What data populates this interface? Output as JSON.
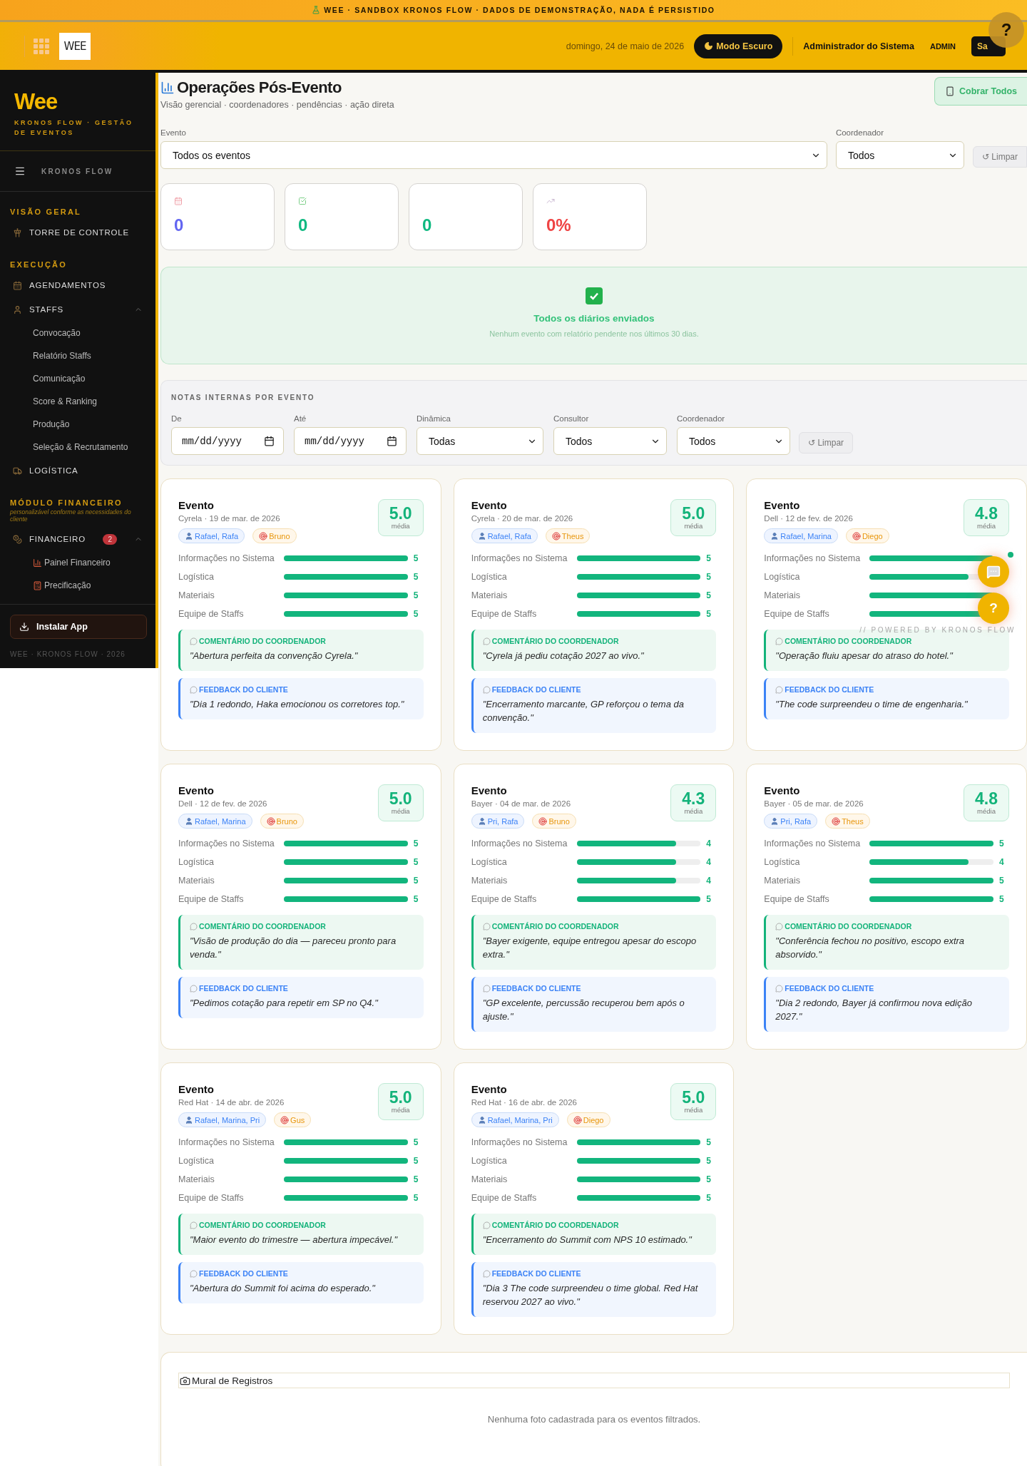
{
  "banner": {
    "text": "WEE · SANDBOX KRONOS FLOW · DADOS DE DEMONSTRAÇÃO, NADA É PERSISTIDO"
  },
  "header": {
    "logo": "WEE",
    "date": "domingo, 24 de maio de 2026",
    "dark_mode_button": "Modo Escuro",
    "user": "Administrador do Sistema",
    "role": "ADMIN",
    "logout_button": "Sa",
    "help_button": "?"
  },
  "sidebar": {
    "brand": "Wee",
    "tagline": "KRONOS FLOW · GESTÃO DE EVENTOS",
    "menu_label": "KRONOS FLOW",
    "sections": [
      {
        "title": "VISÃO GERAL",
        "items": [
          {
            "label": "TORRE DE CONTROLE"
          }
        ]
      },
      {
        "title": "EXECUÇÃO",
        "items": [
          {
            "label": "AGENDAMENTOS"
          },
          {
            "label": "STAFFS",
            "expanded": true,
            "children": [
              {
                "label": "Convocação"
              },
              {
                "label": "Relatório Staffs"
              },
              {
                "label": "Comunicação"
              },
              {
                "label": "Score & Ranking"
              },
              {
                "label": "Produção"
              },
              {
                "label": "Seleção & Recrutamento"
              }
            ]
          },
          {
            "label": "LOGÍSTICA"
          }
        ]
      },
      {
        "title": "MÓDULO FINANCEIRO",
        "note": "personalizável conforme as necessidades do cliente",
        "items": [
          {
            "label": "FINANCEIRO",
            "badge": "2",
            "expanded": true,
            "children": [
              {
                "label": "Painel Financeiro"
              },
              {
                "label": "Precificação"
              }
            ]
          }
        ]
      }
    ],
    "install_button": "Instalar App",
    "footer": "WEE · KRONOS FLOW · 2026"
  },
  "page": {
    "title": "Operações Pós-Evento",
    "subtitle": "Visão gerencial · coordenadores · pendências · ação direta",
    "action_button": "Cobrar Todos"
  },
  "filters": {
    "fields": [
      {
        "label": "Evento",
        "value": "Todos os eventos"
      },
      {
        "label": "Coordenador",
        "value": "Todos"
      }
    ],
    "clear_button": "↺ Limpar"
  },
  "kpis": [
    {
      "value": "0",
      "color": "#6366f1"
    },
    {
      "value": "0",
      "color": "#10b981"
    },
    {
      "value": "0",
      "color": "#10b981"
    },
    {
      "value": "0%",
      "color": "#ef4444"
    }
  ],
  "success": {
    "title": "Todos os diários enviados",
    "text": "Nenhum evento com relatório pendente nos últimos 30 dias."
  },
  "notes": {
    "title": "NOTAS INTERNAS POR EVENTO",
    "fields": [
      {
        "kind": "date",
        "label": "De",
        "placeholder": "mm/dd/yyyy"
      },
      {
        "kind": "date",
        "label": "Até",
        "placeholder": "mm/dd/yyyy"
      },
      {
        "kind": "select",
        "label": "Dinâmica",
        "value": "Todas"
      },
      {
        "kind": "select",
        "label": "Consultor",
        "value": "Todos"
      },
      {
        "kind": "select",
        "label": "Coordenador",
        "value": "Todos"
      }
    ],
    "clear_button": "↺ Limpar"
  },
  "events": [
    {
      "title": "Evento",
      "subtitle": "Cyrela · 19 de mar. de 2026",
      "coordinators": "Rafael, Rafa",
      "consultant": "Bruno",
      "score": "5.0",
      "score_label": "média",
      "ratings": [
        {
          "label": "Informações no Sistema",
          "level": 1,
          "value": "5"
        },
        {
          "label": "Logística",
          "level": 1,
          "value": "5"
        },
        {
          "label": "Materiais",
          "level": 1,
          "value": "5"
        },
        {
          "label": "Equipe de Staffs",
          "level": 1,
          "value": "5"
        }
      ],
      "comment": {
        "label": "COMENTÁRIO DO COORDENADOR",
        "text": "\"Abertura perfeita da convenção Cyrela.\""
      },
      "feedback": {
        "label": "FEEDBACK DO CLIENTE",
        "text": "\"Dia 1 redondo, Haka emocionou os corretores top.\""
      }
    },
    {
      "title": "Evento",
      "subtitle": "Cyrela · 20 de mar. de 2026",
      "coordinators": "Rafael, Rafa",
      "consultant": "Theus",
      "score": "5.0",
      "score_label": "média",
      "ratings": [
        {
          "label": "Informações no Sistema",
          "level": 1,
          "value": "5"
        },
        {
          "label": "Logística",
          "level": 1,
          "value": "5"
        },
        {
          "label": "Materiais",
          "level": 1,
          "value": "5"
        },
        {
          "label": "Equipe de Staffs",
          "level": 1,
          "value": "5"
        }
      ],
      "comment": {
        "label": "COMENTÁRIO DO COORDENADOR",
        "text": "\"Cyrela já pediu cotação 2027 ao vivo.\""
      },
      "feedback": {
        "label": "FEEDBACK DO CLIENTE",
        "text": "\"Encerramento marcante, GP reforçou o tema da convenção.\""
      }
    },
    {
      "title": "Evento",
      "subtitle": "Dell · 12 de fev. de 2026",
      "coordinators": "Rafael, Marina",
      "consultant": "Diego",
      "score": "4.8",
      "score_label": "média",
      "ratings": [
        {
          "label": "Informações no Sistema",
          "level": 1
        },
        {
          "label": "Logística",
          "level": 0.8
        },
        {
          "label": "Materiais",
          "level": 1
        },
        {
          "label": "Equipe de Staffs",
          "level": 1
        }
      ],
      "comment": {
        "label": "COMENTÁRIO DO COORDENADOR",
        "text": "\"Operação fluiu apesar do atraso do hotel.\""
      },
      "feedback": {
        "label": "FEEDBACK DO CLIENTE",
        "text": "\"The code surpreendeu o time de engenharia.\""
      }
    },
    {
      "title": "Evento",
      "subtitle": "Dell · 12 de fev. de 2026",
      "coordinators": "Rafael, Marina",
      "consultant": "Bruno",
      "score": "5.0",
      "score_label": "média",
      "ratings": [
        {
          "label": "Informações no Sistema",
          "level": 1,
          "value": "5"
        },
        {
          "label": "Logística",
          "level": 1,
          "value": "5"
        },
        {
          "label": "Materiais",
          "level": 1,
          "value": "5"
        },
        {
          "label": "Equipe de Staffs",
          "level": 1,
          "value": "5"
        }
      ],
      "comment": {
        "label": "COMENTÁRIO DO COORDENADOR",
        "text": "\"Visão de produção do dia — pareceu pronto para venda.\""
      },
      "feedback": {
        "label": "FEEDBACK DO CLIENTE",
        "text": "\"Pedimos cotação para repetir em SP no Q4.\""
      }
    },
    {
      "title": "Evento",
      "subtitle": "Bayer · 04 de mar. de 2026",
      "coordinators": "Pri, Rafa",
      "consultant": "Bruno",
      "score": "4.3",
      "score_label": "média",
      "ratings": [
        {
          "label": "Informações no Sistema",
          "level": 0.8,
          "value": "4"
        },
        {
          "label": "Logística",
          "level": 0.8,
          "value": "4"
        },
        {
          "label": "Materiais",
          "level": 0.8,
          "value": "4"
        },
        {
          "label": "Equipe de Staffs",
          "level": 1,
          "value": "5"
        }
      ],
      "comment": {
        "label": "COMENTÁRIO DO COORDENADOR",
        "text": "\"Bayer exigente, equipe entregou apesar do escopo extra.\""
      },
      "feedback": {
        "label": "FEEDBACK DO CLIENTE",
        "text": "\"GP excelente, percussão recuperou bem após o ajuste.\""
      }
    },
    {
      "title": "Evento",
      "subtitle": "Bayer · 05 de mar. de 2026",
      "coordinators": "Pri, Rafa",
      "consultant": "Theus",
      "score": "4.8",
      "score_label": "média",
      "ratings": [
        {
          "label": "Informações no Sistema",
          "level": 1,
          "value": "5"
        },
        {
          "label": "Logística",
          "level": 0.8,
          "value": "4"
        },
        {
          "label": "Materiais",
          "level": 1,
          "value": "5"
        },
        {
          "label": "Equipe de Staffs",
          "level": 1,
          "value": "5"
        }
      ],
      "comment": {
        "label": "COMENTÁRIO DO COORDENADOR",
        "text": "\"Conferência fechou no positivo, escopo extra absorvido.\""
      },
      "feedback": {
        "label": "FEEDBACK DO CLIENTE",
        "text": "\"Dia 2 redondo, Bayer já confirmou nova edição 2027.\""
      }
    },
    {
      "title": "Evento",
      "subtitle": "Red Hat · 14 de abr. de 2026",
      "coordinators": "Rafael, Marina, Pri",
      "consultant": "Gus",
      "score": "5.0",
      "score_label": "média",
      "ratings": [
        {
          "label": "Informações no Sistema",
          "level": 1,
          "value": "5"
        },
        {
          "label": "Logística",
          "level": 1,
          "value": "5"
        },
        {
          "label": "Materiais",
          "level": 1,
          "value": "5"
        },
        {
          "label": "Equipe de Staffs",
          "level": 1,
          "value": "5"
        }
      ],
      "comment": {
        "label": "COMENTÁRIO DO COORDENADOR",
        "text": "\"Maior evento do trimestre — abertura impecável.\""
      },
      "feedback": {
        "label": "FEEDBACK DO CLIENTE",
        "text": "\"Abertura do Summit foi acima do esperado.\""
      }
    },
    {
      "title": "Evento",
      "subtitle": "Red Hat · 16 de abr. de 2026",
      "coordinators": "Rafael, Marina, Pri",
      "consultant": "Diego",
      "score": "5.0",
      "score_label": "média",
      "ratings": [
        {
          "label": "Informações no Sistema",
          "level": 1,
          "value": "5"
        },
        {
          "label": "Logística",
          "level": 1,
          "value": "5"
        },
        {
          "label": "Materiais",
          "level": 1,
          "value": "5"
        },
        {
          "label": "Equipe de Staffs",
          "level": 1,
          "value": "5"
        }
      ],
      "comment": {
        "label": "COMENTÁRIO DO COORDENADOR",
        "text": "\"Encerramento do Summit com NPS 10 estimado.\""
      },
      "feedback": {
        "label": "FEEDBACK DO CLIENTE",
        "text": "\"Dia 3 The code surpreendeu o time global. Red Hat reservou 2027 ao vivo.\""
      }
    }
  ],
  "floating": {
    "chat_unread": true,
    "help_button": "?",
    "powered_by": "// POWERED BY KRONOS FLOW"
  },
  "mural": {
    "title": "Mural de Registros",
    "empty_text": "Nenhuma foto cadastrada para os eventos filtrados."
  }
}
